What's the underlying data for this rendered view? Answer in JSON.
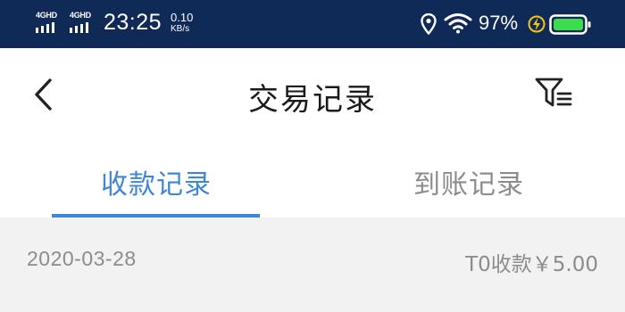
{
  "status_bar": {
    "signal_1_label": "4GHD",
    "signal_2_label": "4GHD",
    "time": "23:25",
    "net_speed_value": "0.10",
    "net_speed_unit": "KB/s",
    "battery_percent": "97%",
    "icons": [
      "signal-icon",
      "signal-icon",
      "location-icon",
      "wifi-icon",
      "charging-icon",
      "battery-icon"
    ],
    "bg_color": "#0f2a57",
    "battery_color": "#3ddc4a",
    "charging_color": "#f5c518"
  },
  "header": {
    "title": "交易记录",
    "back_icon": "chevron-left-icon",
    "filter_icon": "filter-icon"
  },
  "tabs": [
    {
      "label": "收款记录",
      "active": true
    },
    {
      "label": "到账记录",
      "active": false
    }
  ],
  "accent_color": "#3d86d8",
  "records": [
    {
      "date": "2020-03-28",
      "amount": "T0收款￥5.00"
    }
  ]
}
